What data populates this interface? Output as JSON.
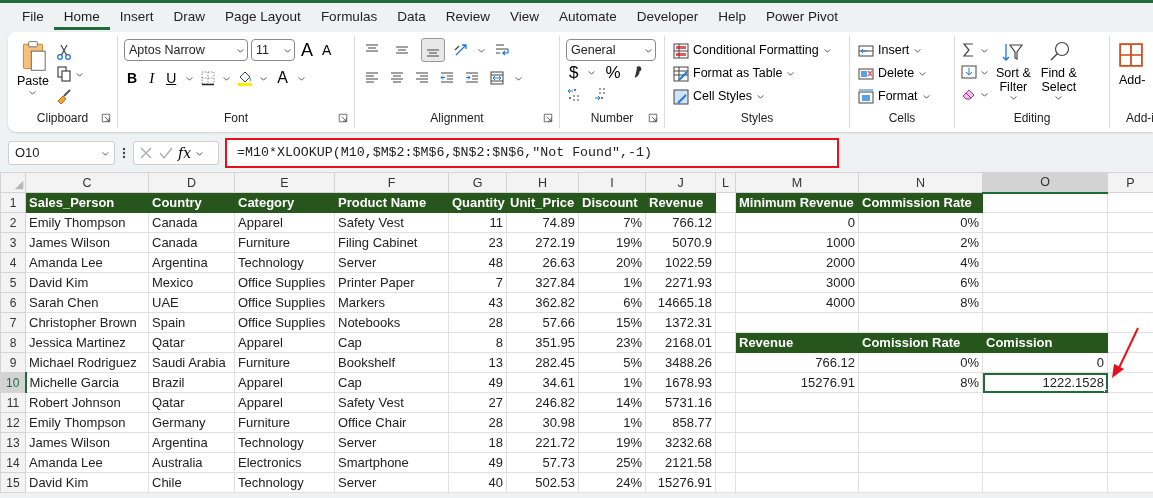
{
  "menu_tabs": [
    {
      "label": "File",
      "selected": false
    },
    {
      "label": "Home",
      "selected": true
    },
    {
      "label": "Insert",
      "selected": false
    },
    {
      "label": "Draw",
      "selected": false
    },
    {
      "label": "Page Layout",
      "selected": false
    },
    {
      "label": "Formulas",
      "selected": false
    },
    {
      "label": "Data",
      "selected": false
    },
    {
      "label": "Review",
      "selected": false
    },
    {
      "label": "View",
      "selected": false
    },
    {
      "label": "Automate",
      "selected": false
    },
    {
      "label": "Developer",
      "selected": false
    },
    {
      "label": "Help",
      "selected": false
    },
    {
      "label": "Power Pivot",
      "selected": false
    }
  ],
  "ribbon": {
    "groups": [
      {
        "kind": "clipboard",
        "label": "Clipboard",
        "paste": "Paste"
      },
      {
        "kind": "font",
        "label": "Font",
        "font_name": "Aptos Narrow",
        "font_size": "11",
        "grow": "A",
        "shrink": "A",
        "bold": "B",
        "italic": "I",
        "underline": "U",
        "font_color": "A"
      },
      {
        "kind": "alignment",
        "label": "Alignment",
        "vertical_align": [
          {
            "kind": "top",
            "selected": false
          },
          {
            "kind": "middle",
            "selected": false
          },
          {
            "kind": "bottom",
            "selected": true
          }
        ]
      },
      {
        "kind": "number",
        "label": "Number",
        "format": "General",
        "currency": "$",
        "percent": "%"
      },
      {
        "kind": "styles",
        "label": "Styles",
        "items": [
          {
            "kind": "conditional",
            "label": "Conditional Formatting"
          },
          {
            "kind": "table",
            "label": "Format as Table"
          },
          {
            "kind": "cell_styles",
            "label": "Cell Styles"
          }
        ]
      },
      {
        "kind": "cells",
        "label": "Cells",
        "items": [
          {
            "kind": "insert",
            "label": "Insert"
          },
          {
            "kind": "delete",
            "label": "Delete"
          },
          {
            "kind": "format",
            "label": "Format"
          }
        ]
      },
      {
        "kind": "editing",
        "label": "Editing",
        "sort": [
          "Sort &",
          "Filter"
        ],
        "find": [
          "Find &",
          "Select"
        ]
      },
      {
        "kind": "addins",
        "label": "Add-i",
        "button": "Add-"
      }
    ]
  },
  "formula_bar": {
    "name_box": "O10",
    "function_label": "fx",
    "formula": "=M10*XLOOKUP(M10,$M$2:$M$6,$N$2:$N$6,\"Not Found\",-1)"
  },
  "sheet": {
    "columns": [
      {
        "letter": "C",
        "selected": false
      },
      {
        "letter": "D",
        "selected": false
      },
      {
        "letter": "E",
        "selected": false
      },
      {
        "letter": "F",
        "selected": false
      },
      {
        "letter": "G",
        "selected": false
      },
      {
        "letter": "H",
        "selected": false
      },
      {
        "letter": "I",
        "selected": false
      },
      {
        "letter": "J",
        "selected": false
      },
      {
        "letter": "L",
        "selected": false
      },
      {
        "letter": "M",
        "selected": false
      },
      {
        "letter": "N",
        "selected": false
      },
      {
        "letter": "O",
        "selected": true
      },
      {
        "letter": "P",
        "selected": false
      }
    ],
    "rows": [
      {
        "number": "1",
        "selected": false,
        "cells": [
          {
            "kind": "head",
            "text": "Sales_Person"
          },
          {
            "kind": "head",
            "text": "Country"
          },
          {
            "kind": "head",
            "text": "Category"
          },
          {
            "kind": "head",
            "text": "Product Name"
          },
          {
            "kind": "head",
            "text": "Quantity"
          },
          {
            "kind": "head",
            "text": "Unit_Price"
          },
          {
            "kind": "head",
            "text": "Discount"
          },
          {
            "kind": "head",
            "text": "Revenue"
          },
          null,
          {
            "kind": "head",
            "text": "Minimum Revenue"
          },
          {
            "kind": "head",
            "text": "Commission Rate"
          },
          null,
          null
        ]
      },
      {
        "number": "2",
        "selected": false,
        "cells": [
          {
            "kind": "text",
            "text": "Emily Thompson"
          },
          {
            "kind": "text",
            "text": "Canada"
          },
          {
            "kind": "text",
            "text": "Apparel"
          },
          {
            "kind": "text",
            "text": "Safety Vest"
          },
          {
            "kind": "num",
            "text": "11"
          },
          {
            "kind": "num",
            "text": "74.89"
          },
          {
            "kind": "num",
            "text": "7%"
          },
          {
            "kind": "num",
            "text": "766.12"
          },
          null,
          {
            "kind": "num",
            "text": "0"
          },
          {
            "kind": "num",
            "text": "0%"
          },
          null,
          null
        ]
      },
      {
        "number": "3",
        "selected": false,
        "cells": [
          {
            "kind": "text",
            "text": "James Wilson"
          },
          {
            "kind": "text",
            "text": "Canada"
          },
          {
            "kind": "text",
            "text": "Furniture"
          },
          {
            "kind": "text",
            "text": "Filing Cabinet"
          },
          {
            "kind": "num",
            "text": "23"
          },
          {
            "kind": "num",
            "text": "272.19"
          },
          {
            "kind": "num",
            "text": "19%"
          },
          {
            "kind": "num",
            "text": "5070.9"
          },
          null,
          {
            "kind": "num",
            "text": "1000"
          },
          {
            "kind": "num",
            "text": "2%"
          },
          null,
          null
        ]
      },
      {
        "number": "4",
        "selected": false,
        "cells": [
          {
            "kind": "text",
            "text": "Amanda Lee"
          },
          {
            "kind": "text",
            "text": "Argentina"
          },
          {
            "kind": "text",
            "text": "Technology"
          },
          {
            "kind": "text",
            "text": "Server"
          },
          {
            "kind": "num",
            "text": "48"
          },
          {
            "kind": "num",
            "text": "26.63"
          },
          {
            "kind": "num",
            "text": "20%"
          },
          {
            "kind": "num",
            "text": "1022.59"
          },
          null,
          {
            "kind": "num",
            "text": "2000"
          },
          {
            "kind": "num",
            "text": "4%"
          },
          null,
          null
        ]
      },
      {
        "number": "5",
        "selected": false,
        "cells": [
          {
            "kind": "text",
            "text": "David Kim"
          },
          {
            "kind": "text",
            "text": "Mexico"
          },
          {
            "kind": "text",
            "text": "Office Supplies"
          },
          {
            "kind": "text",
            "text": "Printer Paper"
          },
          {
            "kind": "num",
            "text": "7"
          },
          {
            "kind": "num",
            "text": "327.84"
          },
          {
            "kind": "num",
            "text": "1%"
          },
          {
            "kind": "num",
            "text": "2271.93"
          },
          null,
          {
            "kind": "num",
            "text": "3000"
          },
          {
            "kind": "num",
            "text": "6%"
          },
          null,
          null
        ]
      },
      {
        "number": "6",
        "selected": false,
        "cells": [
          {
            "kind": "text",
            "text": "Sarah Chen"
          },
          {
            "kind": "text",
            "text": "UAE"
          },
          {
            "kind": "text",
            "text": "Office Supplies"
          },
          {
            "kind": "text",
            "text": "Markers"
          },
          {
            "kind": "num",
            "text": "43"
          },
          {
            "kind": "num",
            "text": "362.82"
          },
          {
            "kind": "num",
            "text": "6%"
          },
          {
            "kind": "num",
            "text": "14665.18"
          },
          null,
          {
            "kind": "num",
            "text": "4000"
          },
          {
            "kind": "num",
            "text": "8%"
          },
          null,
          null
        ]
      },
      {
        "number": "7",
        "selected": false,
        "cells": [
          {
            "kind": "text",
            "text": "Christopher Brown"
          },
          {
            "kind": "text",
            "text": "Spain"
          },
          {
            "kind": "text",
            "text": "Office Supplies"
          },
          {
            "kind": "text",
            "text": "Notebooks"
          },
          {
            "kind": "num",
            "text": "28"
          },
          {
            "kind": "num",
            "text": "57.66"
          },
          {
            "kind": "num",
            "text": "15%"
          },
          {
            "kind": "num",
            "text": "1372.31"
          },
          null,
          null,
          null,
          null,
          null
        ]
      },
      {
        "number": "8",
        "selected": false,
        "cells": [
          {
            "kind": "text",
            "text": "Jessica Martinez"
          },
          {
            "kind": "text",
            "text": "Qatar"
          },
          {
            "kind": "text",
            "text": "Apparel"
          },
          {
            "kind": "text",
            "text": "Cap"
          },
          {
            "kind": "num",
            "text": "8"
          },
          {
            "kind": "num",
            "text": "351.95"
          },
          {
            "kind": "num",
            "text": "23%"
          },
          {
            "kind": "num",
            "text": "2168.01"
          },
          null,
          {
            "kind": "head",
            "text": "Revenue"
          },
          {
            "kind": "head",
            "text": "Comission Rate"
          },
          {
            "kind": "head",
            "text": "Comission"
          },
          null
        ]
      },
      {
        "number": "9",
        "selected": false,
        "cells": [
          {
            "kind": "text",
            "text": "Michael Rodriguez"
          },
          {
            "kind": "text",
            "text": "Saudi Arabia"
          },
          {
            "kind": "text",
            "text": "Furniture"
          },
          {
            "kind": "text",
            "text": "Bookshelf"
          },
          {
            "kind": "num",
            "text": "13"
          },
          {
            "kind": "num",
            "text": "282.45"
          },
          {
            "kind": "num",
            "text": "5%"
          },
          {
            "kind": "num",
            "text": "3488.26"
          },
          null,
          {
            "kind": "num",
            "text": "766.12"
          },
          {
            "kind": "num",
            "text": "0%"
          },
          {
            "kind": "num",
            "text": "0"
          },
          null
        ]
      },
      {
        "number": "10",
        "selected": true,
        "cells": [
          {
            "kind": "text",
            "text": "Michelle Garcia"
          },
          {
            "kind": "text",
            "text": "Brazil"
          },
          {
            "kind": "text",
            "text": "Apparel"
          },
          {
            "kind": "text",
            "text": "Cap"
          },
          {
            "kind": "num",
            "text": "49"
          },
          {
            "kind": "num",
            "text": "34.61"
          },
          {
            "kind": "num",
            "text": "1%"
          },
          {
            "kind": "num",
            "text": "1678.93"
          },
          null,
          {
            "kind": "num",
            "text": "15276.91"
          },
          {
            "kind": "num",
            "text": "8%"
          },
          {
            "kind": "num",
            "text": "1222.1528"
          },
          null
        ]
      },
      {
        "number": "11",
        "selected": false,
        "cells": [
          {
            "kind": "text",
            "text": "Robert Johnson"
          },
          {
            "kind": "text",
            "text": "Qatar"
          },
          {
            "kind": "text",
            "text": "Apparel"
          },
          {
            "kind": "text",
            "text": "Safety Vest"
          },
          {
            "kind": "num",
            "text": "27"
          },
          {
            "kind": "num",
            "text": "246.82"
          },
          {
            "kind": "num",
            "text": "14%"
          },
          {
            "kind": "num",
            "text": "5731.16"
          },
          null,
          null,
          null,
          null,
          null
        ]
      },
      {
        "number": "12",
        "selected": false,
        "cells": [
          {
            "kind": "text",
            "text": "Emily Thompson"
          },
          {
            "kind": "text",
            "text": "Germany"
          },
          {
            "kind": "text",
            "text": "Furniture"
          },
          {
            "kind": "text",
            "text": "Office Chair"
          },
          {
            "kind": "num",
            "text": "28"
          },
          {
            "kind": "num",
            "text": "30.98"
          },
          {
            "kind": "num",
            "text": "1%"
          },
          {
            "kind": "num",
            "text": "858.77"
          },
          null,
          null,
          null,
          null,
          null
        ]
      },
      {
        "number": "13",
        "selected": false,
        "cells": [
          {
            "kind": "text",
            "text": "James Wilson"
          },
          {
            "kind": "text",
            "text": "Argentina"
          },
          {
            "kind": "text",
            "text": "Technology"
          },
          {
            "kind": "text",
            "text": "Server"
          },
          {
            "kind": "num",
            "text": "18"
          },
          {
            "kind": "num",
            "text": "221.72"
          },
          {
            "kind": "num",
            "text": "19%"
          },
          {
            "kind": "num",
            "text": "3232.68"
          },
          null,
          null,
          null,
          null,
          null
        ]
      },
      {
        "number": "14",
        "selected": false,
        "cells": [
          {
            "kind": "text",
            "text": "Amanda Lee"
          },
          {
            "kind": "text",
            "text": "Australia"
          },
          {
            "kind": "text",
            "text": "Electronics"
          },
          {
            "kind": "text",
            "text": "Smartphone"
          },
          {
            "kind": "num",
            "text": "49"
          },
          {
            "kind": "num",
            "text": "57.73"
          },
          {
            "kind": "num",
            "text": "25%"
          },
          {
            "kind": "num",
            "text": "2121.58"
          },
          null,
          null,
          null,
          null,
          null
        ]
      },
      {
        "number": "15",
        "selected": false,
        "cells": [
          {
            "kind": "text",
            "text": "David Kim"
          },
          {
            "kind": "text",
            "text": "Chile"
          },
          {
            "kind": "text",
            "text": "Technology"
          },
          {
            "kind": "text",
            "text": "Server"
          },
          {
            "kind": "num",
            "text": "40"
          },
          {
            "kind": "num",
            "text": "502.53"
          },
          {
            "kind": "num",
            "text": "24%"
          },
          {
            "kind": "num",
            "text": "15276.91"
          },
          null,
          null,
          null,
          null,
          null
        ]
      }
    ]
  }
}
